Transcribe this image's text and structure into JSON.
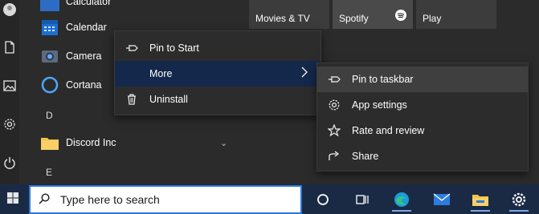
{
  "start_menu": {
    "app_list": {
      "apps": [
        {
          "label": "Calculator"
        },
        {
          "label": "Calendar"
        },
        {
          "label": "Camera"
        },
        {
          "label": "Cortana"
        },
        {
          "label": "Discord Inc"
        }
      ],
      "letters": [
        "D",
        "E"
      ]
    },
    "tiles": [
      {
        "label": "Movies & TV"
      },
      {
        "label": "Spotify"
      },
      {
        "label": "Play"
      }
    ]
  },
  "context_menu": {
    "items": [
      {
        "label": "Pin to Start"
      },
      {
        "label": "More"
      },
      {
        "label": "Uninstall"
      }
    ]
  },
  "submenu": {
    "items": [
      {
        "label": "Pin to taskbar"
      },
      {
        "label": "App settings"
      },
      {
        "label": "Rate and review"
      },
      {
        "label": "Share"
      }
    ]
  },
  "taskbar": {
    "search_placeholder": "Type here to search"
  },
  "colors": {
    "accent": "#2a78d8",
    "menu_active": "#14284b",
    "taskbar": "#1b2a44"
  }
}
